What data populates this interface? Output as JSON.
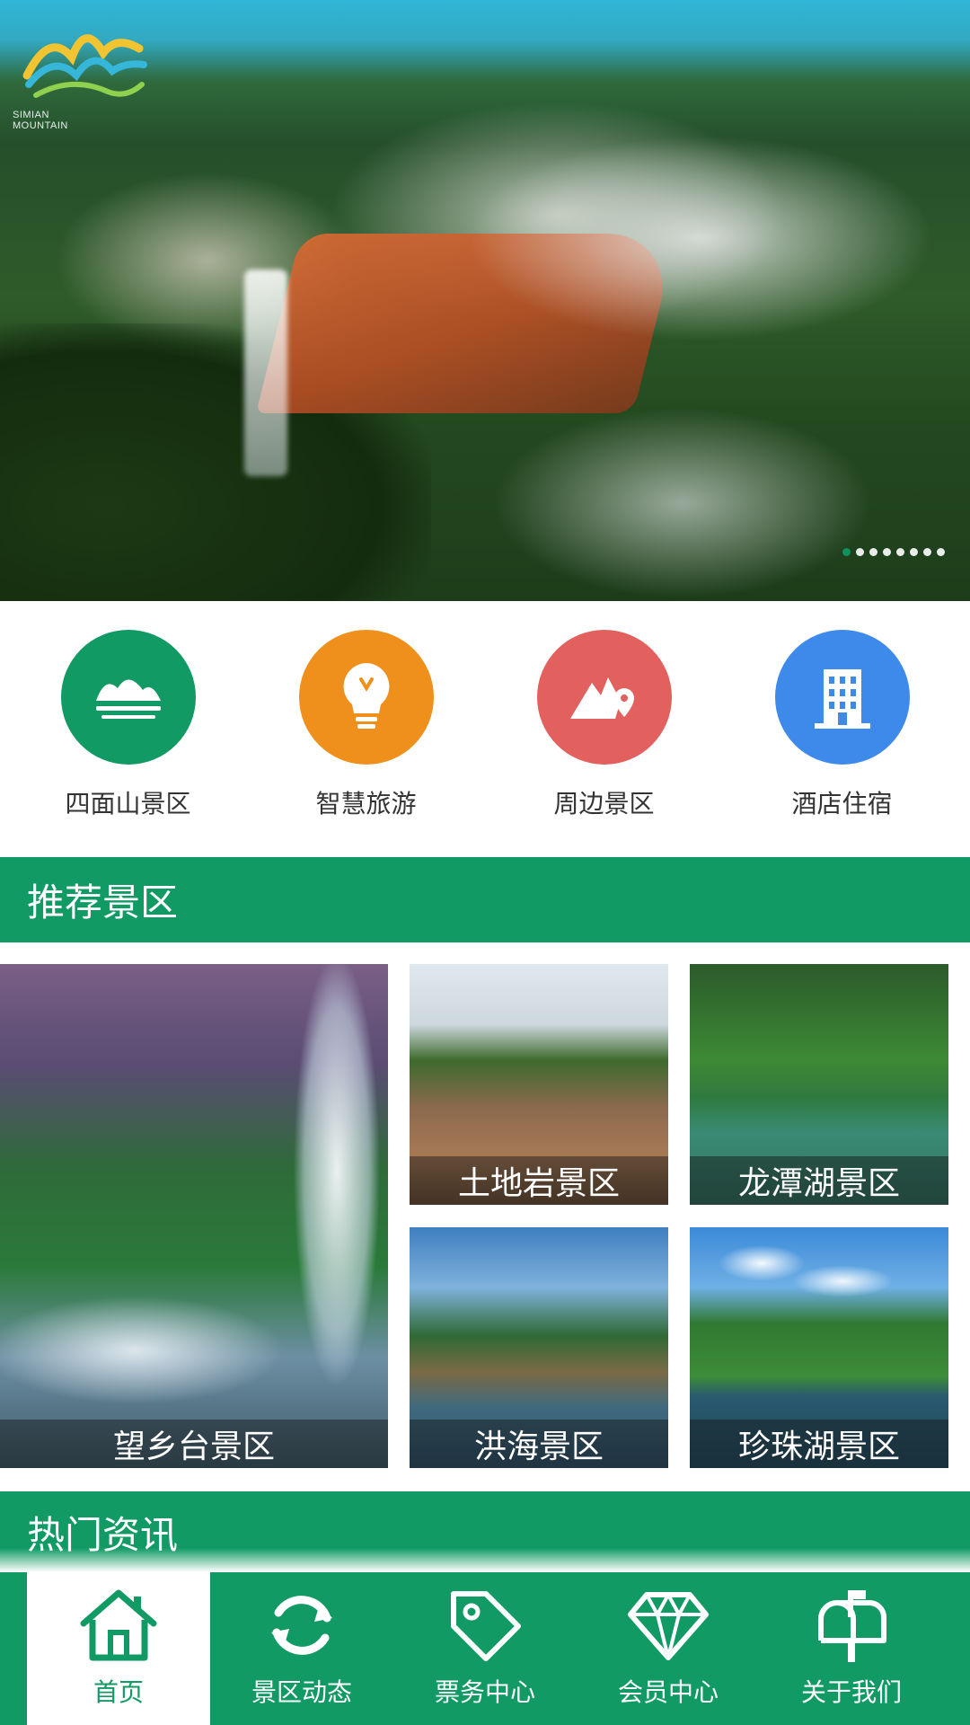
{
  "hero": {
    "logo_text_line1": "SIMIAN",
    "logo_text_line2": "MOUNTAIN",
    "carousel_total": 8,
    "carousel_active_index": 0
  },
  "quicknav": [
    {
      "label": "四面山景区",
      "icon": "mountain-sun-icon",
      "color": "#119a64"
    },
    {
      "label": "智慧旅游",
      "icon": "lightbulb-icon",
      "color": "#f0901c"
    },
    {
      "label": "周边景区",
      "icon": "mountain-pin-icon",
      "color": "#e2615f"
    },
    {
      "label": "酒店住宿",
      "icon": "building-icon",
      "color": "#3d8aea"
    }
  ],
  "recommended": {
    "title": "推荐景区",
    "tiles": [
      {
        "label": "望乡台景区"
      },
      {
        "label": "土地岩景区"
      },
      {
        "label": "龙潭湖景区"
      },
      {
        "label": "洪海景区"
      },
      {
        "label": "珍珠湖景区"
      }
    ]
  },
  "news": {
    "title": "热门资讯"
  },
  "tabbar": [
    {
      "label": "首页",
      "icon": "home-icon",
      "active": true
    },
    {
      "label": "景区动态",
      "icon": "refresh-icon",
      "active": false
    },
    {
      "label": "票务中心",
      "icon": "tag-icon",
      "active": false
    },
    {
      "label": "会员中心",
      "icon": "diamond-icon",
      "active": false
    },
    {
      "label": "关于我们",
      "icon": "mailbox-icon",
      "active": false
    }
  ],
  "colors": {
    "brand_green": "#119a64",
    "white": "#ffffff"
  }
}
